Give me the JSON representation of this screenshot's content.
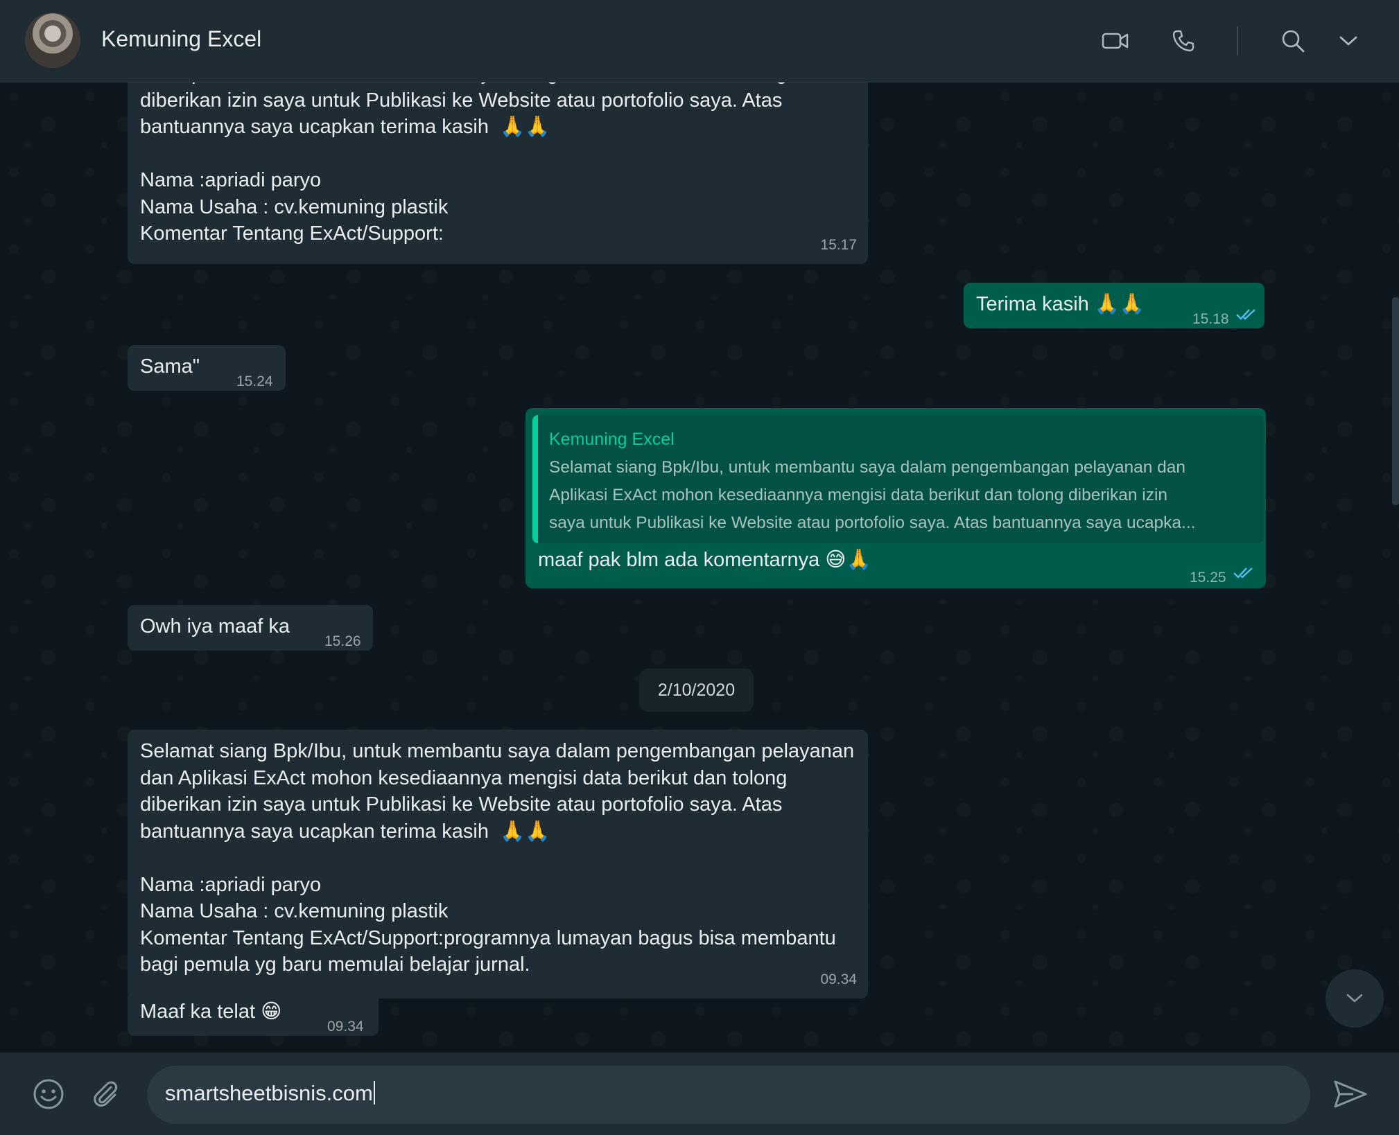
{
  "header": {
    "contact_name": "Kemuning Excel",
    "icons": [
      "video-call-icon",
      "voice-call-icon",
      "search-icon",
      "chevron-down-icon"
    ]
  },
  "messages": [
    {
      "direction": "in",
      "text": "dan Aplikasi ExAct mohon kesediaannya mengisi data berikut dan tolong\ndiberikan izin saya untuk Publikasi ke Website atau portofolio saya. Atas\nbantuannya saya ucapkan terima kasih  🙏🙏\n\nNama :apriadi paryo\nNama Usaha : cv.kemuning plastik\nKomentar Tentang ExAct/Support:",
      "time": "15.17"
    },
    {
      "direction": "out",
      "text": "Terima kasih 🙏🙏",
      "time": "15.18"
    },
    {
      "direction": "in",
      "text": "Sama\"",
      "time": "15.24"
    },
    {
      "direction": "out",
      "quote_author": "Kemuning Excel",
      "quote_text": "Selamat siang Bpk/Ibu, untuk membantu saya dalam pengembangan pelayanan dan\nAplikasi ExAct mohon kesediaannya mengisi data berikut dan tolong diberikan izin\nsaya untuk Publikasi ke Website atau portofolio saya. Atas bantuannya saya ucapka...",
      "text": "maaf pak blm ada komentarnya 😅🙏",
      "time": "15.25"
    },
    {
      "direction": "in",
      "text": "Owh iya maaf ka",
      "time": "15.26"
    },
    {
      "direction": "in",
      "text": "Selamat siang Bpk/Ibu, untuk membantu saya dalam pengembangan pelayanan\ndan Aplikasi ExAct mohon kesediaannya mengisi data berikut dan tolong\ndiberikan izin saya untuk Publikasi ke Website atau portofolio saya. Atas\nbantuannya saya ucapkan terima kasih  🙏🙏\n\nNama :apriadi paryo\nNama Usaha : cv.kemuning plastik\nKomentar Tentang ExAct/Support:programnya lumayan bagus bisa membantu\nbagi pemula yg baru memulai belajar jurnal.",
      "time": "09.34"
    },
    {
      "direction": "in",
      "text": "Maaf ka telat 😁",
      "time": "09.34"
    }
  ],
  "date_separator": "2/10/2020",
  "composer": {
    "value": "smartsheetbisnis.com",
    "icons": [
      "emoji-icon",
      "attach-icon",
      "send-icon"
    ]
  },
  "colors": {
    "header_bg": "#202c33",
    "chat_bg": "#0b141a",
    "incoming_bubble": "#202c33",
    "outgoing_bubble": "#005c4b",
    "accent": "#06cf9c",
    "read_ticks": "#53bdeb"
  }
}
